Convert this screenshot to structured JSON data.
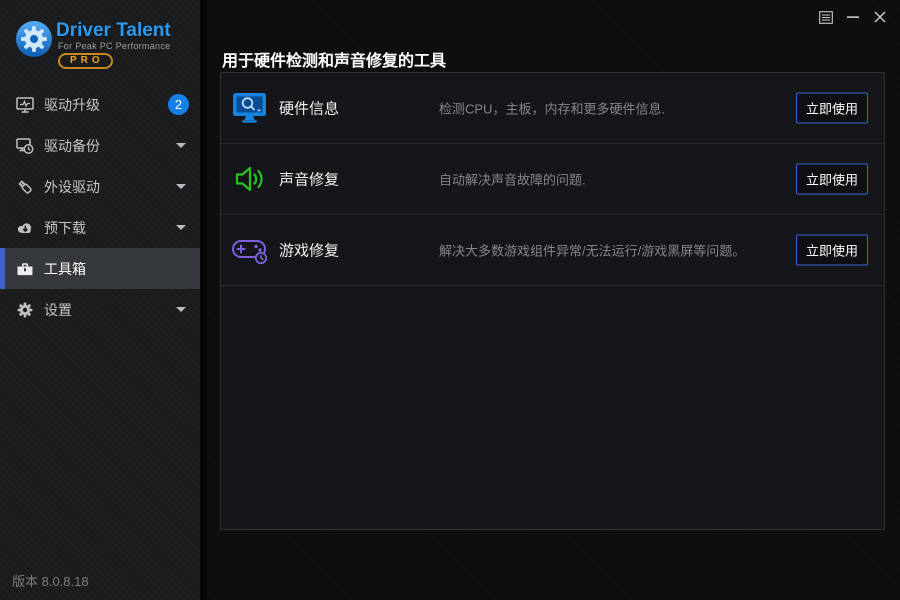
{
  "window": {
    "controls": {
      "menu_icon": "menu-icon",
      "minimize_icon": "minimize-icon",
      "close_icon": "close-icon"
    }
  },
  "logo": {
    "title": "Driver Talent",
    "subtitle": "For Peak PC Performance",
    "badge": "PRO"
  },
  "sidebar": {
    "items": [
      {
        "label": "驱动升级",
        "icon": "monitor-update-icon",
        "badge": "2",
        "selected": false
      },
      {
        "label": "驱动备份",
        "icon": "backup-clock-icon",
        "caret": true,
        "selected": false
      },
      {
        "label": "外设驱动",
        "icon": "usb-drive-icon",
        "caret": true,
        "selected": false
      },
      {
        "label": "预下载",
        "icon": "cloud-download-icon",
        "caret": true,
        "selected": false
      },
      {
        "label": "工具箱",
        "icon": "toolbox-icon",
        "selected": true
      },
      {
        "label": "设置",
        "icon": "gear-icon",
        "caret": true,
        "selected": false
      }
    ],
    "version": "版本 8.0.8.18"
  },
  "main": {
    "heading": "用于硬件检测和声音修复的工具",
    "tools": [
      {
        "name": "硬件信息",
        "description": "检测CPU，主板，内存和更多硬件信息.",
        "action": "立即使用",
        "icon": "hardware-info-icon",
        "accent": "#1583e0"
      },
      {
        "name": "声音修复",
        "description": "自动解决声音故障的问题.",
        "action": "立即使用",
        "icon": "sound-repair-icon",
        "accent": "#25c31f"
      },
      {
        "name": "游戏修复",
        "description": "解决大多数游戏组件异常/无法运行/游戏黑屏等问题。",
        "action": "立即使用",
        "icon": "game-repair-icon",
        "accent": "#7d5fd9"
      }
    ]
  },
  "colors": {
    "sidebar_bg": "#1b1c1e",
    "main_bg": "#0d0e10",
    "panel_bg": "#151619",
    "badge_blue": "#1480e8",
    "selected_border": "#4062c0",
    "button_border": "#3c63d4",
    "logo_blue": "#2d9af0",
    "logo_orange": "#f0a21f",
    "tool_blue": "#1583e0",
    "tool_green": "#25c31f",
    "tool_purple": "#7d5fd9"
  }
}
